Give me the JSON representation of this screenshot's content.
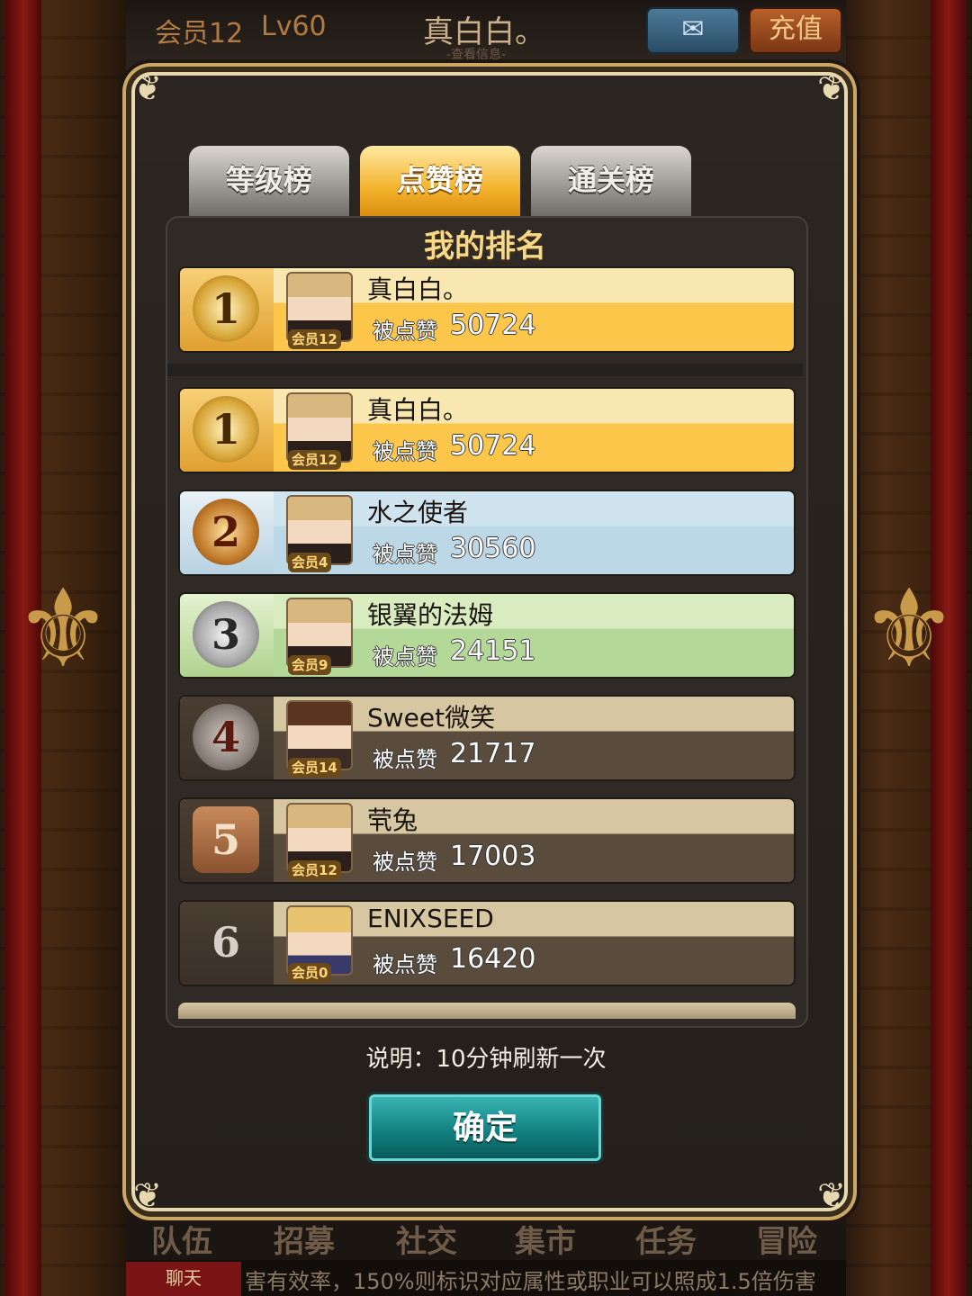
{
  "topbar": {
    "vip": "会员12",
    "level": "Lv60",
    "player_name": "真白白。",
    "view_info": "-查看信息-",
    "mail_icon": "envelope-icon",
    "recharge_label": "充值"
  },
  "tabs": [
    {
      "label": "等级榜",
      "active": false
    },
    {
      "label": "点赞榜",
      "active": true
    },
    {
      "label": "通关榜",
      "active": false
    }
  ],
  "my_rank": {
    "title": "我的排名",
    "entry": {
      "rank": "1",
      "name": "真白白。",
      "vip": "会员12",
      "likes_label": "被点赞",
      "likes": "50724",
      "style": "gold"
    }
  },
  "leaderboard": [
    {
      "rank": "1",
      "name": "真白白。",
      "vip": "会员12",
      "likes_label": "被点赞",
      "likes": "50724",
      "style": "gold"
    },
    {
      "rank": "2",
      "name": "水之使者",
      "vip": "会员4",
      "likes_label": "被点赞",
      "likes": "30560",
      "style": "silver"
    },
    {
      "rank": "3",
      "name": "银翼的法姆",
      "vip": "会员9",
      "likes_label": "被点赞",
      "likes": "24151",
      "style": "green"
    },
    {
      "rank": "4",
      "name": "Sweet微笑",
      "vip": "会员14",
      "likes_label": "被点赞",
      "likes": "21717",
      "style": "plain"
    },
    {
      "rank": "5",
      "name": "茕兔",
      "vip": "会员12",
      "likes_label": "被点赞",
      "likes": "17003",
      "style": "plain"
    },
    {
      "rank": "6",
      "name": "ENIXSEED",
      "vip": "会员0",
      "likes_label": "被点赞",
      "likes": "16420",
      "style": "plain"
    }
  ],
  "note": "说明：10分钟刷新一次",
  "confirm_label": "确定",
  "bottom_nav": [
    "队伍",
    "招募",
    "社交",
    "集市",
    "任务",
    "冒险"
  ],
  "chat": {
    "label": "聊天",
    "ticker": "害有效率，150%则标识对应属性或职业可以照成1.5倍伤害"
  }
}
